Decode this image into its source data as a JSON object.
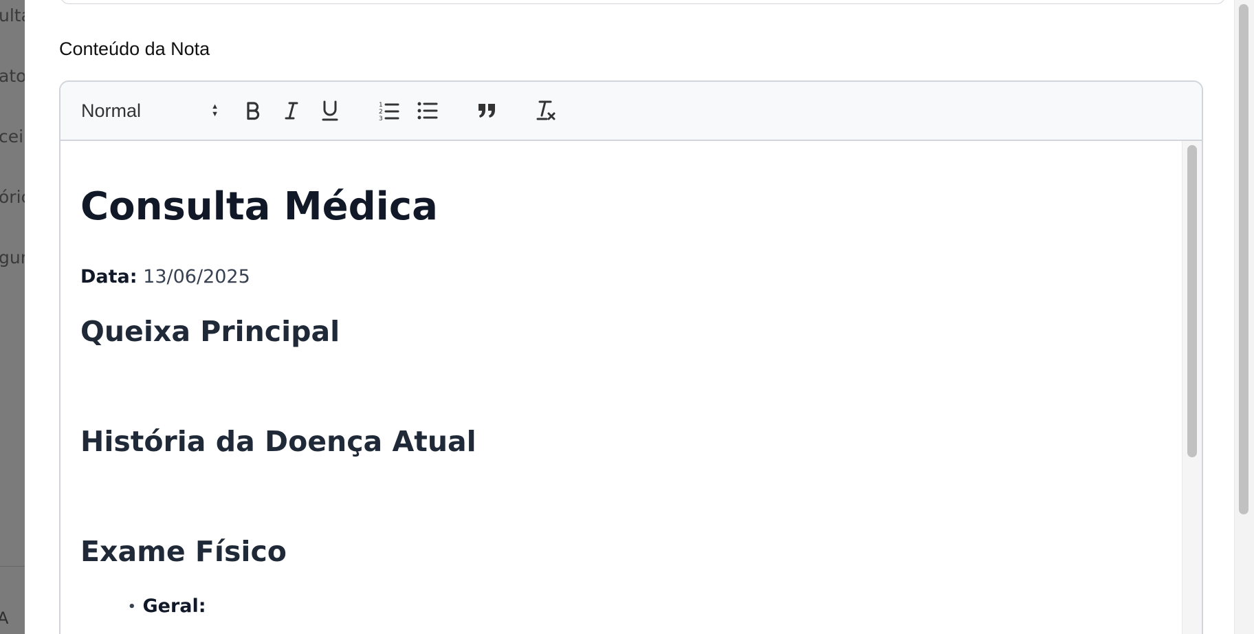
{
  "sidebar_peek": {
    "items": [
      "ulta",
      "atos",
      "cei",
      "óric",
      "gur"
    ],
    "bottom_glyph": "A"
  },
  "form": {
    "label": "Conteúdo da Nota"
  },
  "toolbar": {
    "format_select": "Normal",
    "icons": [
      "bold-icon",
      "italic-icon",
      "underline-icon",
      "ordered-list-icon",
      "bullet-list-icon",
      "quote-icon",
      "clear-format-icon"
    ]
  },
  "note": {
    "title": "Consulta Médica",
    "date_label": "Data:",
    "date_value": "13/06/2025",
    "sections": [
      "Queixa Principal",
      "História da Doença Atual",
      "Exame Físico"
    ],
    "exam_items": [
      "Geral:"
    ]
  }
}
